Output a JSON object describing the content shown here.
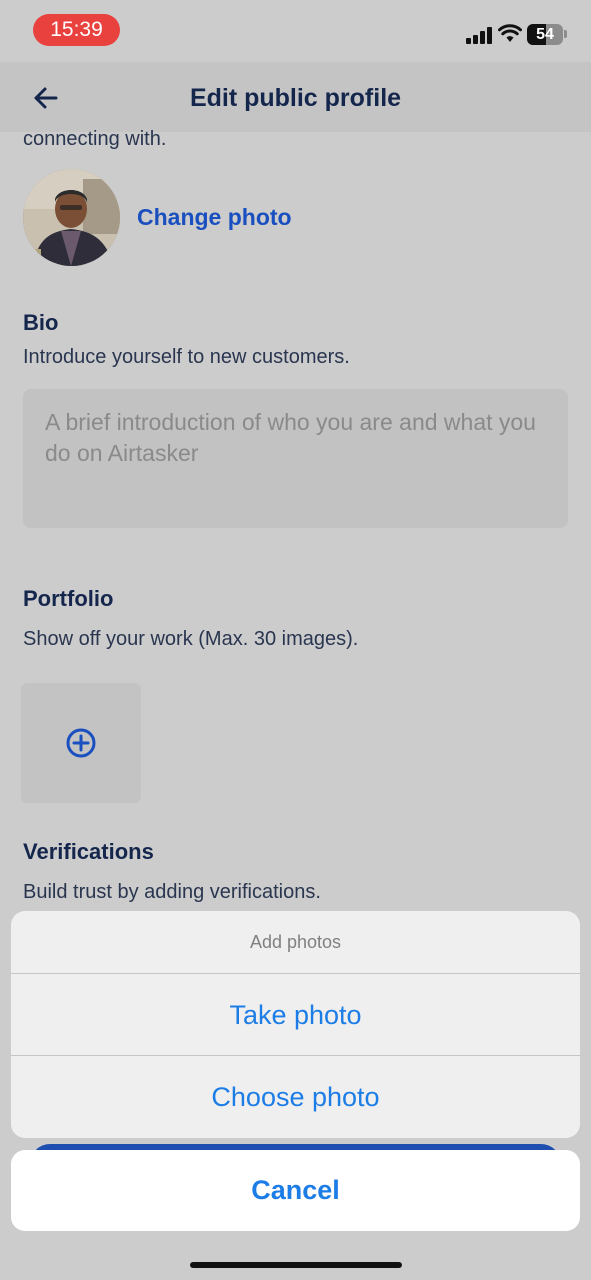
{
  "status_bar": {
    "time": "15:39",
    "battery": "54",
    "battery_level": 0.54
  },
  "header": {
    "title": "Edit public profile",
    "back_icon": "back-arrow-icon"
  },
  "profile": {
    "partial_text": "connecting with.",
    "change_photo_label": "Change photo"
  },
  "bio": {
    "heading": "Bio",
    "subtitle": "Introduce yourself to new customers.",
    "placeholder": "A brief introduction of who you are and what you do on Airtasker"
  },
  "portfolio": {
    "heading": "Portfolio",
    "subtitle": "Show off your work (Max. 30 images).",
    "add_icon": "plus-circle-icon"
  },
  "verifications": {
    "heading": "Verifications",
    "subtitle": "Build trust by adding verifications."
  },
  "action_sheet": {
    "title": "Add photos",
    "options": [
      "Take photo",
      "Choose photo"
    ],
    "cancel": "Cancel"
  },
  "colors": {
    "accent": "#1a4fbf",
    "ios_blue": "#1d7de6",
    "title": "#15264d",
    "time_pill": "#e8413e"
  }
}
